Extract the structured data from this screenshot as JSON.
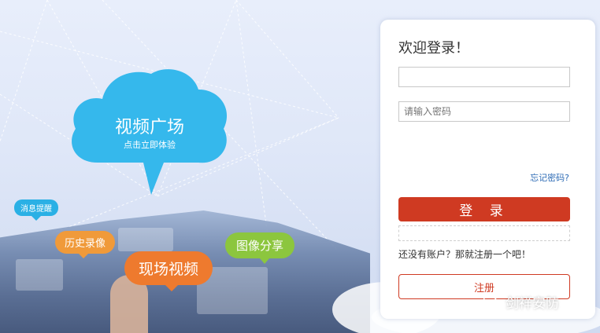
{
  "hero": {
    "cloud_title": "视频广场",
    "cloud_subtitle": "点击立即体验",
    "bubble_messages": "消息提醒",
    "bubble_history": "历史录像",
    "bubble_live": "现场视频",
    "bubble_share": "图像分享"
  },
  "login": {
    "welcome": "欢迎登录！",
    "username_value": "",
    "password_placeholder": "请输入密码",
    "forgot_link": "忘记密码?",
    "login_button": "登 录",
    "no_account_text": "还没有账户？那就注册一个吧！",
    "register_button": "注册"
  },
  "watermark": {
    "text": "剑祥安防",
    "icon": "wechat-icon"
  },
  "colors": {
    "primary_red": "#cf3a22",
    "cloud_blue": "#35b8ec",
    "orange": "#ee7a2e",
    "green": "#8cc63e",
    "link_blue": "#2d6bb5"
  }
}
